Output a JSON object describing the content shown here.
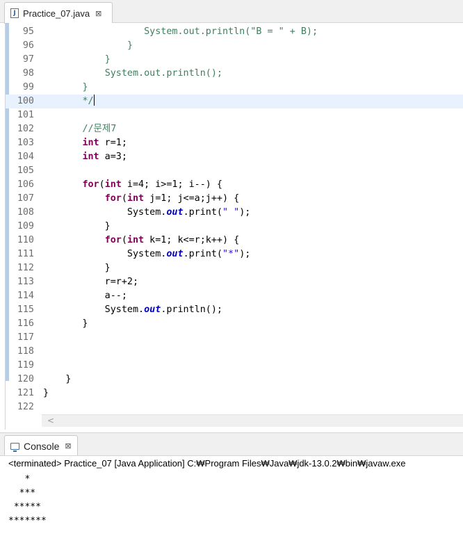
{
  "editor": {
    "tab_label": "Practice_07.java",
    "file_icon_letter": "J",
    "close_glyph": "⊠",
    "lines": [
      {
        "n": "95",
        "tokens": [
          {
            "t": "                  "
          },
          {
            "t": "System.out.println(\"B = \" + B);",
            "c": "cmt"
          }
        ]
      },
      {
        "n": "96",
        "tokens": [
          {
            "t": "               "
          },
          {
            "t": "}",
            "c": "cmt"
          }
        ]
      },
      {
        "n": "97",
        "tokens": [
          {
            "t": "           "
          },
          {
            "t": "}",
            "c": "cmt"
          }
        ]
      },
      {
        "n": "98",
        "tokens": [
          {
            "t": "           "
          },
          {
            "t": "System.out.println();",
            "c": "cmt"
          }
        ]
      },
      {
        "n": "99",
        "tokens": [
          {
            "t": "       "
          },
          {
            "t": "}",
            "c": "cmt"
          }
        ]
      },
      {
        "n": "100",
        "current": true,
        "caret": true,
        "tokens": [
          {
            "t": "       "
          },
          {
            "t": "*/",
            "c": "cmt"
          }
        ]
      },
      {
        "n": "101",
        "tokens": []
      },
      {
        "n": "102",
        "tokens": [
          {
            "t": "       "
          },
          {
            "t": "//문제7",
            "c": "cmt"
          }
        ]
      },
      {
        "n": "103",
        "tokens": [
          {
            "t": "       "
          },
          {
            "t": "int",
            "c": "kw"
          },
          {
            "t": " r=1;"
          }
        ]
      },
      {
        "n": "104",
        "tokens": [
          {
            "t": "       "
          },
          {
            "t": "int",
            "c": "kw"
          },
          {
            "t": " a=3;"
          }
        ]
      },
      {
        "n": "105",
        "tokens": []
      },
      {
        "n": "106",
        "tokens": [
          {
            "t": "       "
          },
          {
            "t": "for",
            "c": "kw"
          },
          {
            "t": "("
          },
          {
            "t": "int",
            "c": "kw"
          },
          {
            "t": " i=4; i>=1; i--) {"
          }
        ]
      },
      {
        "n": "107",
        "tokens": [
          {
            "t": "           "
          },
          {
            "t": "for",
            "c": "kw"
          },
          {
            "t": "("
          },
          {
            "t": "int",
            "c": "kw"
          },
          {
            "t": " j=1; j<=a;j++) {"
          }
        ]
      },
      {
        "n": "108",
        "tokens": [
          {
            "t": "               System."
          },
          {
            "t": "out",
            "c": "fld"
          },
          {
            "t": ".print("
          },
          {
            "t": "\" \"",
            "c": "str"
          },
          {
            "t": ");"
          }
        ]
      },
      {
        "n": "109",
        "tokens": [
          {
            "t": "           }"
          }
        ]
      },
      {
        "n": "110",
        "tokens": [
          {
            "t": "           "
          },
          {
            "t": "for",
            "c": "kw"
          },
          {
            "t": "("
          },
          {
            "t": "int",
            "c": "kw"
          },
          {
            "t": " k=1; k<=r;k++) {"
          }
        ]
      },
      {
        "n": "111",
        "tokens": [
          {
            "t": "               System."
          },
          {
            "t": "out",
            "c": "fld"
          },
          {
            "t": ".print("
          },
          {
            "t": "\"*\"",
            "c": "str"
          },
          {
            "t": ");"
          }
        ]
      },
      {
        "n": "112",
        "tokens": [
          {
            "t": "           }"
          }
        ]
      },
      {
        "n": "113",
        "tokens": [
          {
            "t": "           r=r+2;"
          }
        ]
      },
      {
        "n": "114",
        "tokens": [
          {
            "t": "           a--;"
          }
        ]
      },
      {
        "n": "115",
        "tokens": [
          {
            "t": "           System."
          },
          {
            "t": "out",
            "c": "fld"
          },
          {
            "t": ".println();"
          }
        ]
      },
      {
        "n": "116",
        "tokens": [
          {
            "t": "       }"
          }
        ]
      },
      {
        "n": "117",
        "tokens": []
      },
      {
        "n": "118",
        "tokens": []
      },
      {
        "n": "119",
        "tokens": []
      },
      {
        "n": "120",
        "tokens": [
          {
            "t": "    }"
          }
        ]
      },
      {
        "n": "121",
        "tokens": [
          {
            "t": "}"
          }
        ]
      },
      {
        "n": "122",
        "tokens": []
      }
    ],
    "scroll_left_glyph": "<"
  },
  "console": {
    "tab_label": "Console",
    "close_glyph": "⊠",
    "status": "<terminated> Practice_07 [Java Application] C:₩Program Files₩Java₩jdk-13.0.2₩bin₩javaw.exe",
    "output": [
      "   *",
      "  ***",
      " *****",
      "*******"
    ]
  },
  "colors": {
    "keyword": "#7f0055",
    "string": "#2a00ff",
    "comment": "#3f7f5f",
    "field": "#0000c0",
    "current_line": "#e8f2fe",
    "ruler": "#b7cde6"
  }
}
